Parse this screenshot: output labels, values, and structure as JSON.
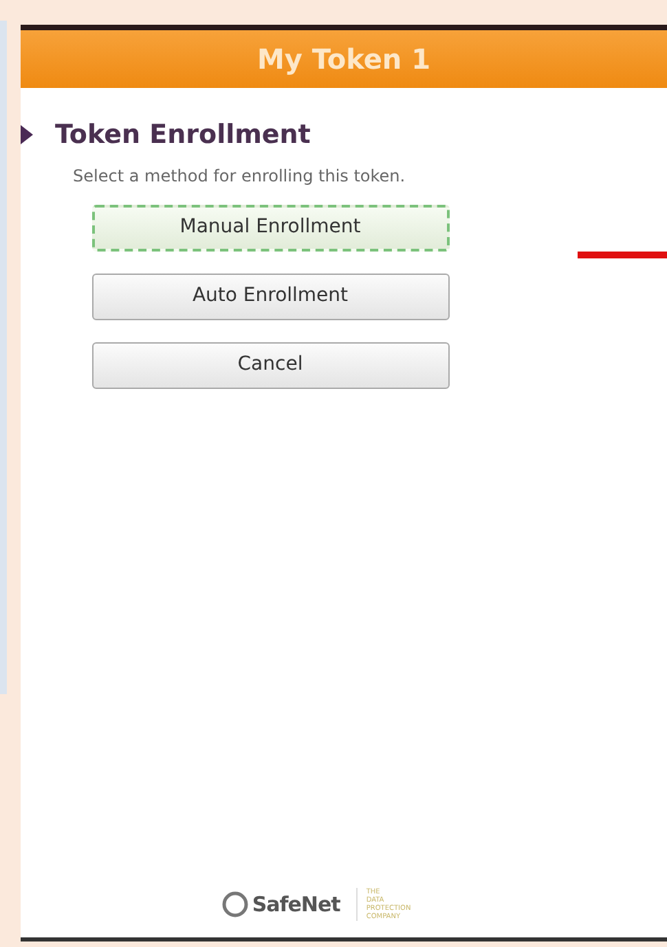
{
  "window": {
    "title": "My Token 1"
  },
  "section": {
    "title": "Token Enrollment",
    "description": "Select a method for enrolling this token."
  },
  "buttons": [
    {
      "label": "Manual Enrollment",
      "focused": true
    },
    {
      "label": "Auto Enrollment",
      "focused": false
    },
    {
      "label": "Cancel",
      "focused": false
    }
  ],
  "footer": {
    "logo": "SafeNet",
    "tagline": [
      "THE",
      "DATA",
      "PROTECTION",
      "COMPANY"
    ]
  }
}
